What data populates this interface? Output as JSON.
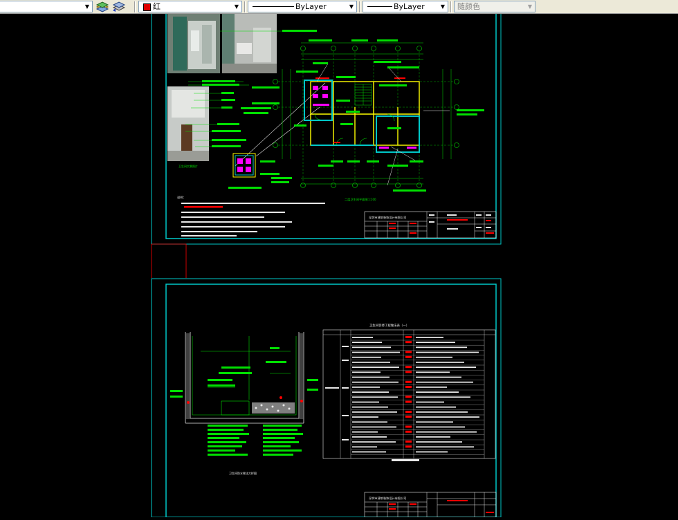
{
  "toolbar": {
    "layer_dropdown": {
      "value": ""
    },
    "color_dropdown": {
      "value": "红",
      "swatch_color": "#e00000"
    },
    "linetype_dropdown": {
      "value": "ByLayer"
    },
    "lineweight_dropdown": {
      "value": "ByLayer"
    },
    "plotstyle_dropdown": {
      "value": "随颜色"
    }
  },
  "colors": {
    "frame": "#00c8c8",
    "drawing": "#00e000",
    "accent_red": "#ff0000",
    "magenta": "#ff00ff",
    "yellow": "#ffff00",
    "blue": "#6060ff"
  },
  "sheet1": {
    "company": "深圳市建筑装饰设计有限公司",
    "plan_caption": "二层卫生间平面图",
    "plan_scale": "1:100",
    "notes_label": "说明："
  },
  "sheet2": {
    "table_title": "卫生间装修工程做法表（一）",
    "section_caption": "卫生间防水做法大样图",
    "company": "深圳市建筑装饰设计有限公司"
  }
}
